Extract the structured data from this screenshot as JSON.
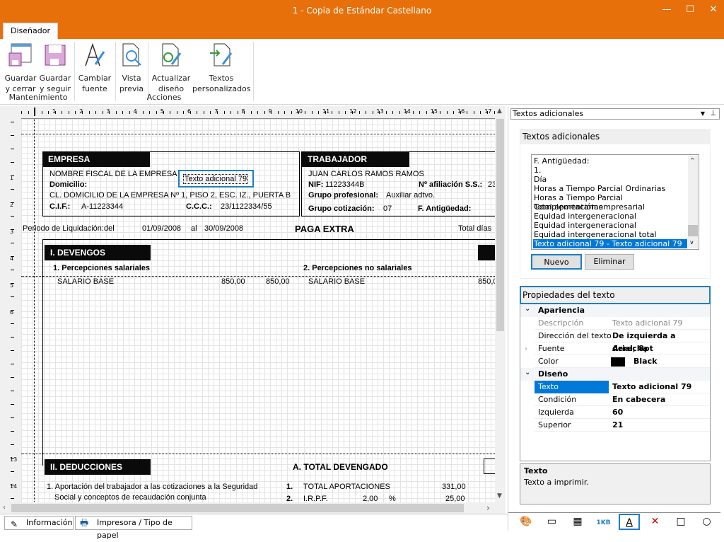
{
  "window": {
    "title": "1 - Copia de Estándar Castellano",
    "minimize": "—",
    "maximize": "☐",
    "close": "✕"
  },
  "colors": {
    "accent": "#E8700A",
    "selection": "#0078D7",
    "focus": "#1E7FC4"
  },
  "ribbon": {
    "tab": "Diseñador",
    "buttons": [
      {
        "l1": "Guardar",
        "l2": "y cerrar",
        "icon": "save-close-icon"
      },
      {
        "l1": "Guardar",
        "l2": "y seguir",
        "icon": "save-icon"
      },
      {
        "l1": "Cambiar",
        "l2": "fuente",
        "icon": "font-pen-icon"
      },
      {
        "l1": "Vista",
        "l2": "previa",
        "icon": "preview-icon"
      },
      {
        "l1": "Actualizar",
        "l2": "diseño",
        "icon": "refresh-design-icon"
      },
      {
        "l1": "Textos",
        "l2": "personalizados",
        "icon": "custom-texts-icon"
      }
    ],
    "groups": [
      "Mantenimiento",
      "Acciones"
    ]
  },
  "ruler": {
    "top": [
      "1",
      "2",
      "3",
      "4",
      "5",
      "6",
      "7",
      "8",
      "9",
      "10",
      "11",
      "12",
      "13",
      "14",
      "15",
      "16",
      "17"
    ],
    "left": [
      "1",
      "2",
      "3",
      "4",
      "5",
      "6",
      "13",
      "14"
    ]
  },
  "doc": {
    "empresa": {
      "title": "EMPRESA",
      "name": "NOMBRE FISCAL DE LA EMPRESA",
      "dom_label": "Domicilio:",
      "address": "CL. DOMICILIO DE LA EMPRESA Nº 1, PISO 2, ESC. IZ., PUERTA B",
      "cif_label": "C.I.F.:",
      "cif": "A-11223344",
      "ccc_label": "C.C.C.:",
      "ccc": "23/1122334/55"
    },
    "selected_text": "Texto adicional 79",
    "trabajador": {
      "title": "TRABAJADOR",
      "name": "JUAN CARLOS RAMOS RAMOS",
      "nif_label": "NIF:",
      "nif": "11223344B",
      "afil_label": "Nº afiliación S.S.:",
      "afil": "23",
      "grupo_prof_label": "Grupo profesional:",
      "grupo_prof": "Auxiliar adtvo.",
      "grupo_cot_label": "Grupo cotización:",
      "grupo_cot": "07",
      "antig_label": "F. Antigüedad:"
    },
    "periodo": {
      "label": "Periodo de Liquidación:del",
      "from": "01/09/2008",
      "al": "al",
      "to": "30/09/2008",
      "title": "PAGA EXTRA",
      "total": "Total días"
    },
    "devengos": {
      "title": "I. DEVENGOS",
      "col1": "1. Percepciones salariales",
      "col2": "2. Percepciones no salariales",
      "row": {
        "c1": "SALARIO BASE",
        "v1": "850,00",
        "v2": "850,00",
        "c2": "SALARIO BASE",
        "v3": "850,0"
      }
    },
    "deducciones": {
      "title": "II. DEDUCCIONES",
      "total": "A. TOTAL DEVENGADO",
      "item1a": "1. Aportación del trabajador a las cotizaciones a la Seguridad",
      "item1b": "Social y conceptos de recaudación conjunta",
      "r1n": "1.",
      "r1": "TOTAL APORTACIONES",
      "r1v": "331,00",
      "r2n": "2.",
      "r2": "I.R.P.F.",
      "r2p": "2,00",
      "r2pc": "%",
      "r2v": "25,00"
    }
  },
  "status_tabs": [
    "Información",
    "Impresora / Tipo de papel"
  ],
  "panel": {
    "dropdown": "Textos adicionales",
    "section": "Textos adicionales",
    "list": [
      "F. Antigüedad:",
      "1.",
      "Día",
      "Horas a Tiempo Parcial Ordinarias",
      "Horas a Tiempo Parcial Complementarias",
      "Total aportación empresarial",
      "Equidad intergeneracional",
      "Equidad intergeneracional",
      "Equidad intergeneracional total",
      "Texto adicional 79 - Texto adicional 79"
    ],
    "new": "Nuevo",
    "delete": "Eliminar",
    "props_title": "Propiedades del texto",
    "cat1": "Apariencia",
    "props1": [
      {
        "k": "Descripción",
        "v": "Texto adicional 79"
      },
      {
        "k": "Dirección del texto",
        "v": "De izquierda a derecha"
      },
      {
        "k": "Fuente",
        "v": "Arial; 8pt"
      },
      {
        "k": "Color",
        "v": "Black"
      }
    ],
    "cat2": "Diseño",
    "props2": [
      {
        "k": "Texto",
        "v": "Texto adicional 79"
      },
      {
        "k": "Condición",
        "v": "En cabecera"
      },
      {
        "k": "Izquierda",
        "v": "60"
      },
      {
        "k": "Superior",
        "v": "21"
      }
    ],
    "help_title": "Texto",
    "help_text": "Texto a imprimir.",
    "tools": [
      "palette-icon",
      "image-icon",
      "table-icon",
      "barcode-icon",
      "text-icon",
      "line-icon",
      "rectangle-icon",
      "ellipse-icon"
    ],
    "barcode_label": "1KB"
  }
}
